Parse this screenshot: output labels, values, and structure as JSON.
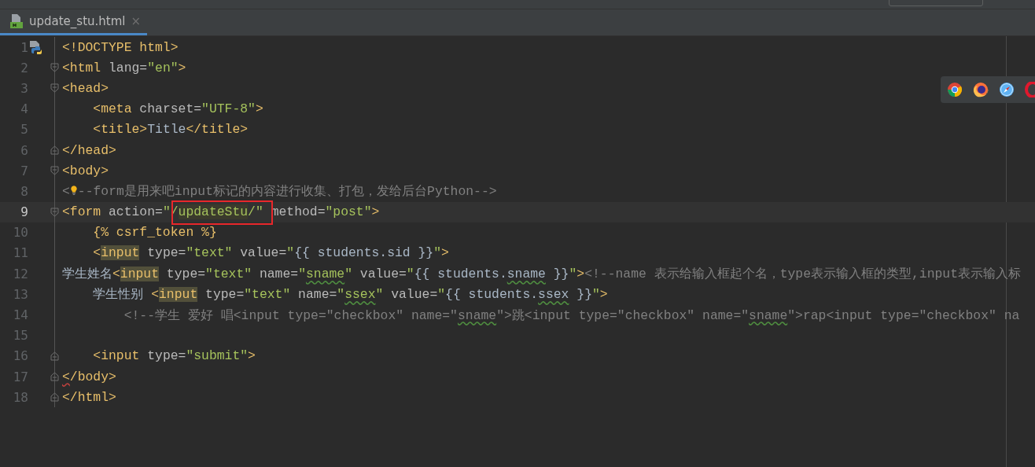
{
  "tabs": [
    {
      "label": "update_stu.html",
      "close": "×",
      "selected": true
    }
  ],
  "editor": {
    "lines": [
      {
        "number": "1",
        "kind": "plain",
        "gutter_icon": true,
        "current": false,
        "tokens": [
          {
            "kind": "tag",
            "text": "<!DOCTYPE html>"
          }
        ]
      },
      {
        "number": "2",
        "kind": "fold-start",
        "current": false,
        "tokens": [
          {
            "kind": "tag",
            "text": "<html"
          },
          {
            "kind": "attr",
            "text": " lang="
          },
          {
            "kind": "str",
            "text": "\"en\""
          },
          {
            "kind": "tag",
            "text": ">"
          }
        ]
      },
      {
        "number": "3",
        "kind": "fold-start",
        "current": false,
        "tokens": [
          {
            "kind": "tag",
            "text": "<head>"
          }
        ]
      },
      {
        "number": "4",
        "kind": "plain",
        "current": false,
        "tokens": [
          {
            "kind": "tag",
            "text": "    <meta"
          },
          {
            "kind": "attr",
            "text": " charset="
          },
          {
            "kind": "str",
            "text": "\"UTF-8\""
          },
          {
            "kind": "tag",
            "text": ">"
          }
        ]
      },
      {
        "number": "5",
        "kind": "plain",
        "current": false,
        "tokens": [
          {
            "kind": "tag",
            "text": "    <title>"
          },
          {
            "kind": "text",
            "text": "Title"
          },
          {
            "kind": "tag",
            "text": "</title>"
          }
        ]
      },
      {
        "number": "6",
        "kind": "fold-end",
        "current": false,
        "tokens": [
          {
            "kind": "tag",
            "text": "</head>"
          }
        ]
      },
      {
        "number": "7",
        "kind": "fold-start",
        "current": false,
        "tokens": [
          {
            "kind": "tag",
            "text": "<body>"
          }
        ]
      },
      {
        "number": "8",
        "kind": "plain",
        "lightbulb": true,
        "current": false,
        "tokens": [
          {
            "kind": "comment",
            "text": "<"
          },
          {
            "kind": "comment-gap",
            "text": "--form是用来吧input标记的内容进行收集、打包，发给后台Python-->"
          }
        ]
      },
      {
        "number": "9",
        "kind": "fold-start",
        "current": true,
        "tokens": [
          {
            "kind": "tag",
            "text": "<form"
          },
          {
            "kind": "attr",
            "text": " action="
          },
          {
            "kind": "str",
            "text": "\"/"
          },
          {
            "kind": "str-hl",
            "text": "updateStu"
          },
          {
            "kind": "str",
            "text": "/\""
          },
          {
            "kind": "attr",
            "text": " method="
          },
          {
            "kind": "str",
            "text": "\"post\""
          },
          {
            "kind": "tag",
            "text": ">"
          }
        ]
      },
      {
        "number": "10",
        "kind": "plain",
        "current": false,
        "tokens": [
          {
            "kind": "tag",
            "text": "    {% csrf_token %}"
          }
        ]
      },
      {
        "number": "11",
        "kind": "plain",
        "current": false,
        "tokens": [
          {
            "kind": "tag",
            "text": "    <"
          },
          {
            "kind": "tag-hl",
            "text": "input"
          },
          {
            "kind": "attr",
            "text": " type="
          },
          {
            "kind": "str",
            "text": "\"text\""
          },
          {
            "kind": "attr",
            "text": " value="
          },
          {
            "kind": "str",
            "text": "\""
          },
          {
            "kind": "text",
            "text": "{{ students.sid }}"
          },
          {
            "kind": "str",
            "text": "\""
          },
          {
            "kind": "tag",
            "text": ">"
          }
        ]
      },
      {
        "number": "12",
        "kind": "plain",
        "current": false,
        "tokens": [
          {
            "kind": "text",
            "text": "学生姓名"
          },
          {
            "kind": "tag",
            "text": "<"
          },
          {
            "kind": "tag-hl",
            "text": "input"
          },
          {
            "kind": "attr",
            "text": " type="
          },
          {
            "kind": "str",
            "text": "\"text\""
          },
          {
            "kind": "attr",
            "text": " name="
          },
          {
            "kind": "str",
            "text": "\""
          },
          {
            "kind": "str-typo",
            "text": "sname"
          },
          {
            "kind": "str",
            "text": "\""
          },
          {
            "kind": "attr",
            "text": " value="
          },
          {
            "kind": "str",
            "text": "\""
          },
          {
            "kind": "text",
            "text": "{{ students."
          },
          {
            "kind": "text-typo",
            "text": "sname"
          },
          {
            "kind": "text",
            "text": " }}"
          },
          {
            "kind": "str",
            "text": "\""
          },
          {
            "kind": "tag",
            "text": ">"
          },
          {
            "kind": "comment",
            "text": "<!--name 表示给输入框起个名，type表示输入框的类型,input表示输入标"
          }
        ]
      },
      {
        "number": "13",
        "kind": "plain",
        "current": false,
        "tokens": [
          {
            "kind": "text",
            "text": "    学生性别 "
          },
          {
            "kind": "tag",
            "text": "<"
          },
          {
            "kind": "tag-hl",
            "text": "input"
          },
          {
            "kind": "attr",
            "text": " type="
          },
          {
            "kind": "str",
            "text": "\"text\""
          },
          {
            "kind": "attr",
            "text": " name="
          },
          {
            "kind": "str",
            "text": "\""
          },
          {
            "kind": "str-typo",
            "text": "ssex"
          },
          {
            "kind": "str",
            "text": "\""
          },
          {
            "kind": "attr",
            "text": " value="
          },
          {
            "kind": "str",
            "text": "\""
          },
          {
            "kind": "text",
            "text": "{{ students."
          },
          {
            "kind": "text-typo",
            "text": "ssex"
          },
          {
            "kind": "text",
            "text": " }}"
          },
          {
            "kind": "str",
            "text": "\""
          },
          {
            "kind": "tag",
            "text": ">"
          }
        ]
      },
      {
        "number": "14",
        "kind": "plain",
        "current": false,
        "tokens": [
          {
            "kind": "comment",
            "text": "        <!--学生 爱好 唱<input type=\"checkbox\" name=\""
          },
          {
            "kind": "comment-typo",
            "text": "sname"
          },
          {
            "kind": "comment",
            "text": "\">跳<input type=\"checkbox\" name=\""
          },
          {
            "kind": "comment-typo",
            "text": "sname"
          },
          {
            "kind": "comment",
            "text": "\">rap<input type=\"checkbox\" na"
          }
        ]
      },
      {
        "number": "15",
        "kind": "plain",
        "current": false
      },
      {
        "number": "16",
        "kind": "fold-end",
        "current": false,
        "tokens": [
          {
            "kind": "tag",
            "text": "    <input"
          },
          {
            "kind": "attr",
            "text": " type="
          },
          {
            "kind": "str",
            "text": "\"submit\""
          },
          {
            "kind": "tag",
            "text": ">"
          }
        ]
      },
      {
        "number": "17",
        "kind": "fold-end",
        "current": false,
        "tokens": [
          {
            "kind": "error",
            "text": "<"
          },
          {
            "kind": "tag",
            "text": "/body>"
          }
        ]
      },
      {
        "number": "18",
        "kind": "fold-end",
        "current": false,
        "tokens": [
          {
            "kind": "tag",
            "text": "</html>"
          }
        ]
      }
    ]
  }
}
